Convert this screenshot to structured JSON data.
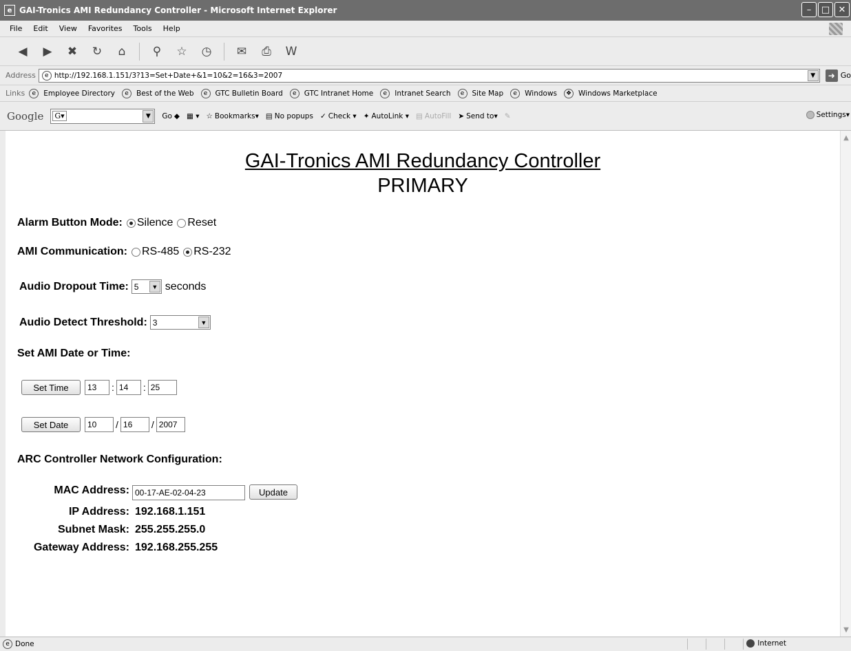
{
  "window": {
    "title": "GAI-Tronics AMI Redundancy Controller - Microsoft Internet Explorer",
    "controls": [
      "–",
      "□",
      "✕"
    ]
  },
  "menu": [
    "File",
    "Edit",
    "View",
    "Favorites",
    "Tools",
    "Help"
  ],
  "address": {
    "label": "Address",
    "url": "http://192.168.1.151/3?13=Set+Date+&1=10&2=16&3=2007",
    "go_label": "Go"
  },
  "links": {
    "label": "Links",
    "items": [
      "Employee Directory",
      "Best of the Web",
      "GTC Bulletin Board",
      "GTC Intranet Home",
      "Intranet Search",
      "Site Map",
      "Windows",
      "Windows Marketplace"
    ]
  },
  "googlebar": {
    "logo": "Google",
    "search_mark": "G▾",
    "go": "Go",
    "bookmarks": "Bookmarks▾",
    "popups": "No popups",
    "check": "Check ▾",
    "autolink": "AutoLink ▾",
    "autofill": "AutoFill",
    "sendto": "Send to▾",
    "settings": "Settings▾"
  },
  "page": {
    "title": "GAI-Tronics AMI Redundancy Controller",
    "subtitle": "PRIMARY",
    "alarm": {
      "label": "Alarm Button Mode:",
      "options": [
        {
          "label": "Silence",
          "checked": true
        },
        {
          "label": "Reset",
          "checked": false
        }
      ]
    },
    "comm": {
      "label": "AMI Communication:",
      "options": [
        {
          "label": "RS-485",
          "checked": false
        },
        {
          "label": "RS-232",
          "checked": true
        }
      ]
    },
    "dropout": {
      "label": "Audio Dropout Time:",
      "value": "5",
      "unit": "seconds"
    },
    "threshold": {
      "label": "Audio Detect Threshold:",
      "value": "3"
    },
    "datetime_heading": "Set AMI Date or Time:",
    "time": {
      "button": "Set Time",
      "hour": "13",
      "minute": "14",
      "second": "25",
      "sep": ":"
    },
    "date": {
      "button": "Set Date",
      "month": "10",
      "day": "16",
      "year": "2007",
      "sep": "/"
    },
    "network_heading": "ARC Controller Network Configuration:",
    "network": {
      "mac_label": "MAC Address:",
      "mac_value": "00-17-AE-02-04-23",
      "update_button": "Update",
      "ip_label": "IP Address:",
      "ip_value": "192.168.1.151",
      "subnet_label": "Subnet Mask:",
      "subnet_value": "255.255.255.0",
      "gateway_label": "Gateway Address:",
      "gateway_value": "192.168.255.255"
    }
  },
  "status": {
    "text": "Done",
    "zone": "Internet"
  }
}
